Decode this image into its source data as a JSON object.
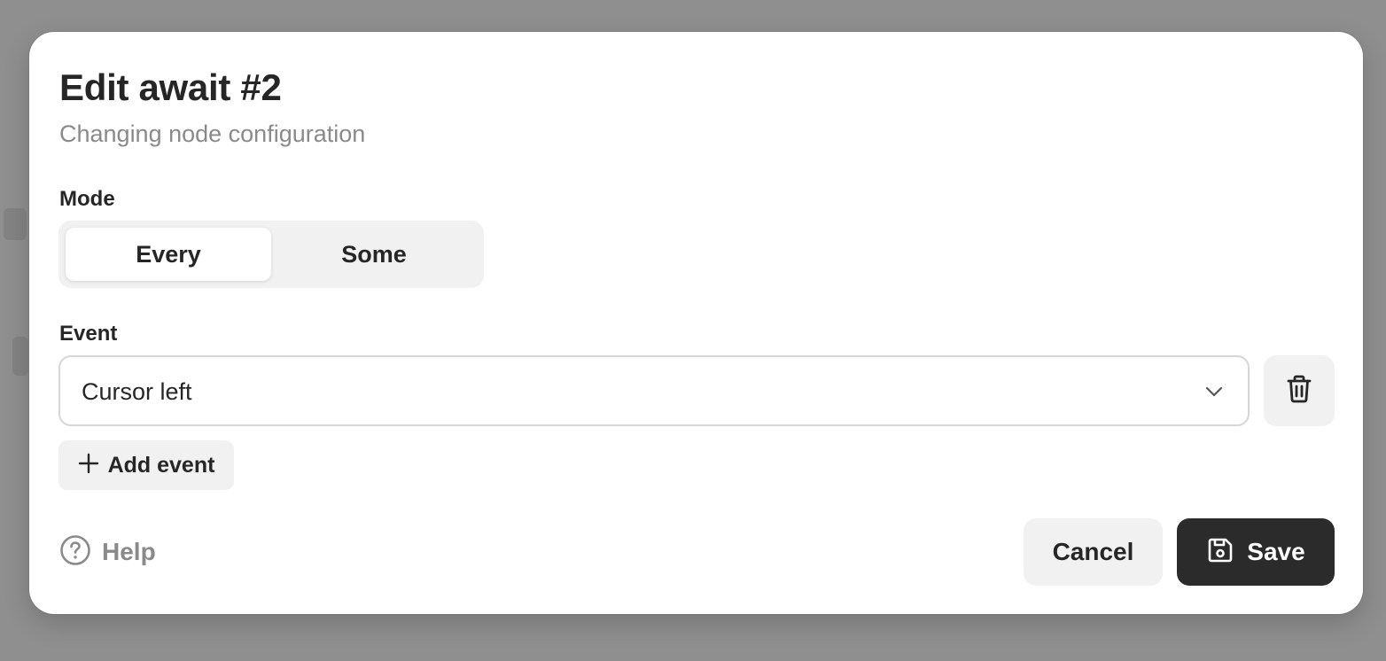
{
  "dialog": {
    "title": "Edit await #2",
    "subtitle": "Changing node configuration"
  },
  "mode": {
    "label": "Mode",
    "options": [
      "Every",
      "Some"
    ],
    "selected": "Every"
  },
  "event": {
    "label": "Event",
    "value": "Cursor left",
    "add_label": "Add event"
  },
  "footer": {
    "help_label": "Help",
    "cancel_label": "Cancel",
    "save_label": "Save"
  },
  "icons": {
    "chevron": "chevron-down-icon",
    "delete": "trash-icon",
    "add": "plus-icon",
    "help": "question-circle-icon",
    "save": "floppy-disk-icon"
  },
  "colors": {
    "primary_button": "#2b2b2b",
    "secondary_button": "#f1f1f1",
    "muted_text": "#8a8a8a",
    "text": "#262626"
  }
}
